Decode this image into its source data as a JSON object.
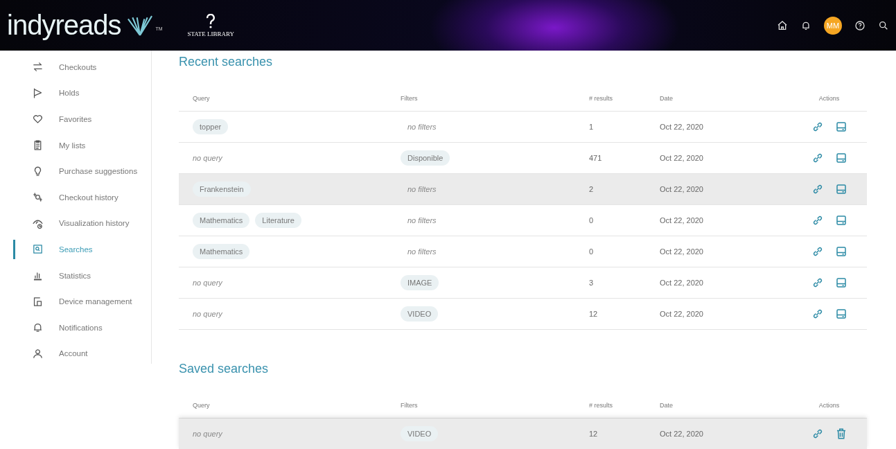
{
  "header": {
    "logo": "indyreads",
    "trademark": "TM",
    "partner_logo": "STATE LIBRARY",
    "avatar": "MM"
  },
  "sidebar": {
    "items": [
      {
        "label": "Checkouts",
        "selected": false
      },
      {
        "label": "Holds",
        "selected": false
      },
      {
        "label": "Favorites",
        "selected": false
      },
      {
        "label": "My lists",
        "selected": false
      },
      {
        "label": "Purchase suggestions",
        "selected": false
      },
      {
        "label": "Checkout history",
        "selected": false
      },
      {
        "label": "Visualization history",
        "selected": false
      },
      {
        "label": "Searches",
        "selected": true
      },
      {
        "label": "Statistics",
        "selected": false
      },
      {
        "label": "Device management",
        "selected": false
      },
      {
        "label": "Notifications",
        "selected": false
      },
      {
        "label": "Account",
        "selected": false
      }
    ]
  },
  "sections": [
    {
      "title": "Recent searches",
      "columns": [
        "Query",
        "Filters",
        "# results",
        "Date",
        "Actions"
      ],
      "rows": [
        {
          "selected": false,
          "query": {
            "kind": "tags",
            "tags": [
              "topper"
            ]
          },
          "filters": {
            "kind": "empty",
            "text": "no filters"
          },
          "results": "1",
          "date": "Oct 22, 2020",
          "actions": [
            {
              "kind": "link"
            },
            {
              "kind": "save"
            }
          ]
        },
        {
          "selected": false,
          "query": {
            "kind": "empty",
            "text": "no query"
          },
          "filters": {
            "kind": "tags",
            "tags": [
              "Disponible"
            ]
          },
          "results": "471",
          "date": "Oct 22, 2020",
          "actions": [
            {
              "kind": "link"
            },
            {
              "kind": "save"
            }
          ]
        },
        {
          "selected": true,
          "query": {
            "kind": "tags",
            "tags": [
              "Frankenstein"
            ]
          },
          "filters": {
            "kind": "empty",
            "text": "no filters"
          },
          "results": "2",
          "date": "Oct 22, 2020",
          "actions": [
            {
              "kind": "link"
            },
            {
              "kind": "save"
            }
          ]
        },
        {
          "selected": false,
          "query": {
            "kind": "tags",
            "tags": [
              "Mathematics",
              "Literature"
            ]
          },
          "filters": {
            "kind": "empty",
            "text": "no filters"
          },
          "results": "0",
          "date": "Oct 22, 2020",
          "actions": [
            {
              "kind": "link"
            },
            {
              "kind": "save"
            }
          ]
        },
        {
          "selected": false,
          "query": {
            "kind": "tags",
            "tags": [
              "Mathematics"
            ]
          },
          "filters": {
            "kind": "empty",
            "text": "no filters"
          },
          "results": "0",
          "date": "Oct 22, 2020",
          "actions": [
            {
              "kind": "link"
            },
            {
              "kind": "save"
            }
          ]
        },
        {
          "selected": false,
          "query": {
            "kind": "empty",
            "text": "no query"
          },
          "filters": {
            "kind": "tags",
            "tags": [
              "IMAGE"
            ]
          },
          "results": "3",
          "date": "Oct 22, 2020",
          "actions": [
            {
              "kind": "link"
            },
            {
              "kind": "save"
            }
          ]
        },
        {
          "selected": false,
          "query": {
            "kind": "empty",
            "text": "no query"
          },
          "filters": {
            "kind": "tags",
            "tags": [
              "VIDEO"
            ]
          },
          "results": "12",
          "date": "Oct 22, 2020",
          "actions": [
            {
              "kind": "link"
            },
            {
              "kind": "save"
            }
          ]
        }
      ]
    },
    {
      "title": "Saved searches",
      "columns": [
        "Query",
        "Filters",
        "# results",
        "Date",
        "Actions"
      ],
      "rows": [
        {
          "selected": true,
          "query": {
            "kind": "empty",
            "text": "no query"
          },
          "filters": {
            "kind": "tags",
            "tags": [
              "VIDEO"
            ]
          },
          "results": "12",
          "date": "Oct 22, 2020",
          "actions": [
            {
              "kind": "link"
            },
            {
              "kind": "delete"
            }
          ]
        }
      ]
    }
  ]
}
